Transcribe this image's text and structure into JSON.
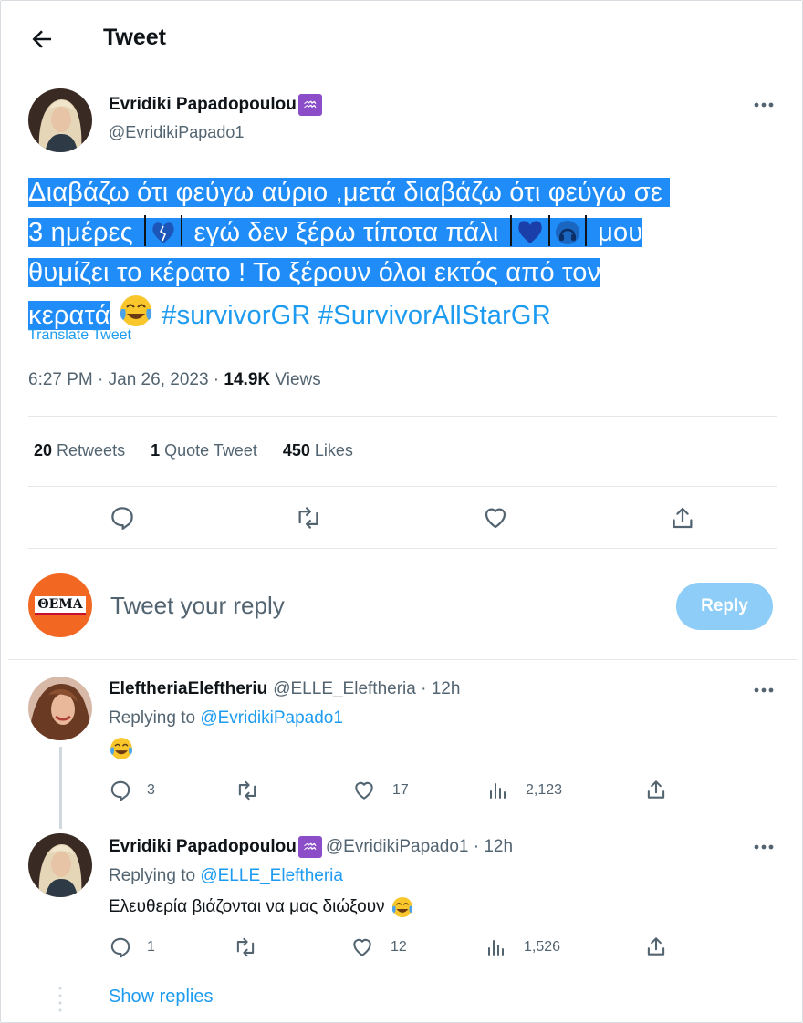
{
  "header": {
    "title": "Tweet"
  },
  "tweet": {
    "author_name": "Evridiki Papadopoulou",
    "author_handle": "@EvridikiPapado1",
    "zodiac": "♒",
    "text": {
      "l1": "Διαβάζω ότι φεύγω αύριο ,μετά διαβάζω ότι φεύγω σε",
      "l2a": "3 ημέρες",
      "l2b": "εγώ δεν ξέρω τίποτα πάλι",
      "l2c": "μου",
      "l3": "θυμίζει το κέρατο ! Το ξέρουν όλοι εκτός από τον",
      "l4": "κερατά"
    },
    "hashtags": "#survivorGR #SurvivorAllStarGR",
    "translate": "Translate Tweet",
    "time": "6:27 PM · Jan 26, 2023 · ",
    "views_count": "14.9K",
    "views_label": " Views",
    "stats": {
      "retweets_count": "20",
      "retweets_label": " Retweets",
      "quotes_count": "1",
      "quotes_label": " Quote Tweet",
      "likes_count": "450",
      "likes_label": " Likes"
    }
  },
  "reply_box": {
    "logo": "ΘΕΜΑ",
    "placeholder": "Tweet your reply",
    "button": "Reply"
  },
  "replies": [
    {
      "name": "EleftheriaEleftheriu",
      "handle_time": "@ELLE_Eleftheria · 12h",
      "replying_label": "Replying to ",
      "replying_to": "@EvridikiPapado1",
      "text": "",
      "replies": "3",
      "likes": "17",
      "views": "2,123"
    },
    {
      "name": "Evridiki Papadopoulou",
      "zodiac": "♒",
      "handle_time": "@EvridikiPapado1 · 12h",
      "replying_label": "Replying to ",
      "replying_to": "@ELLE_Eleftheria",
      "text": "Ελευθερία βιάζονται να μας διώξουν",
      "replies": "1",
      "likes": "12",
      "views": "1,526"
    }
  ],
  "show_replies": "Show replies",
  "colors": {
    "accent": "#1d9bf0",
    "highlight": "#1f8cf7",
    "reply_button": "#8ecdf8",
    "logo_bg": "#f26722"
  }
}
